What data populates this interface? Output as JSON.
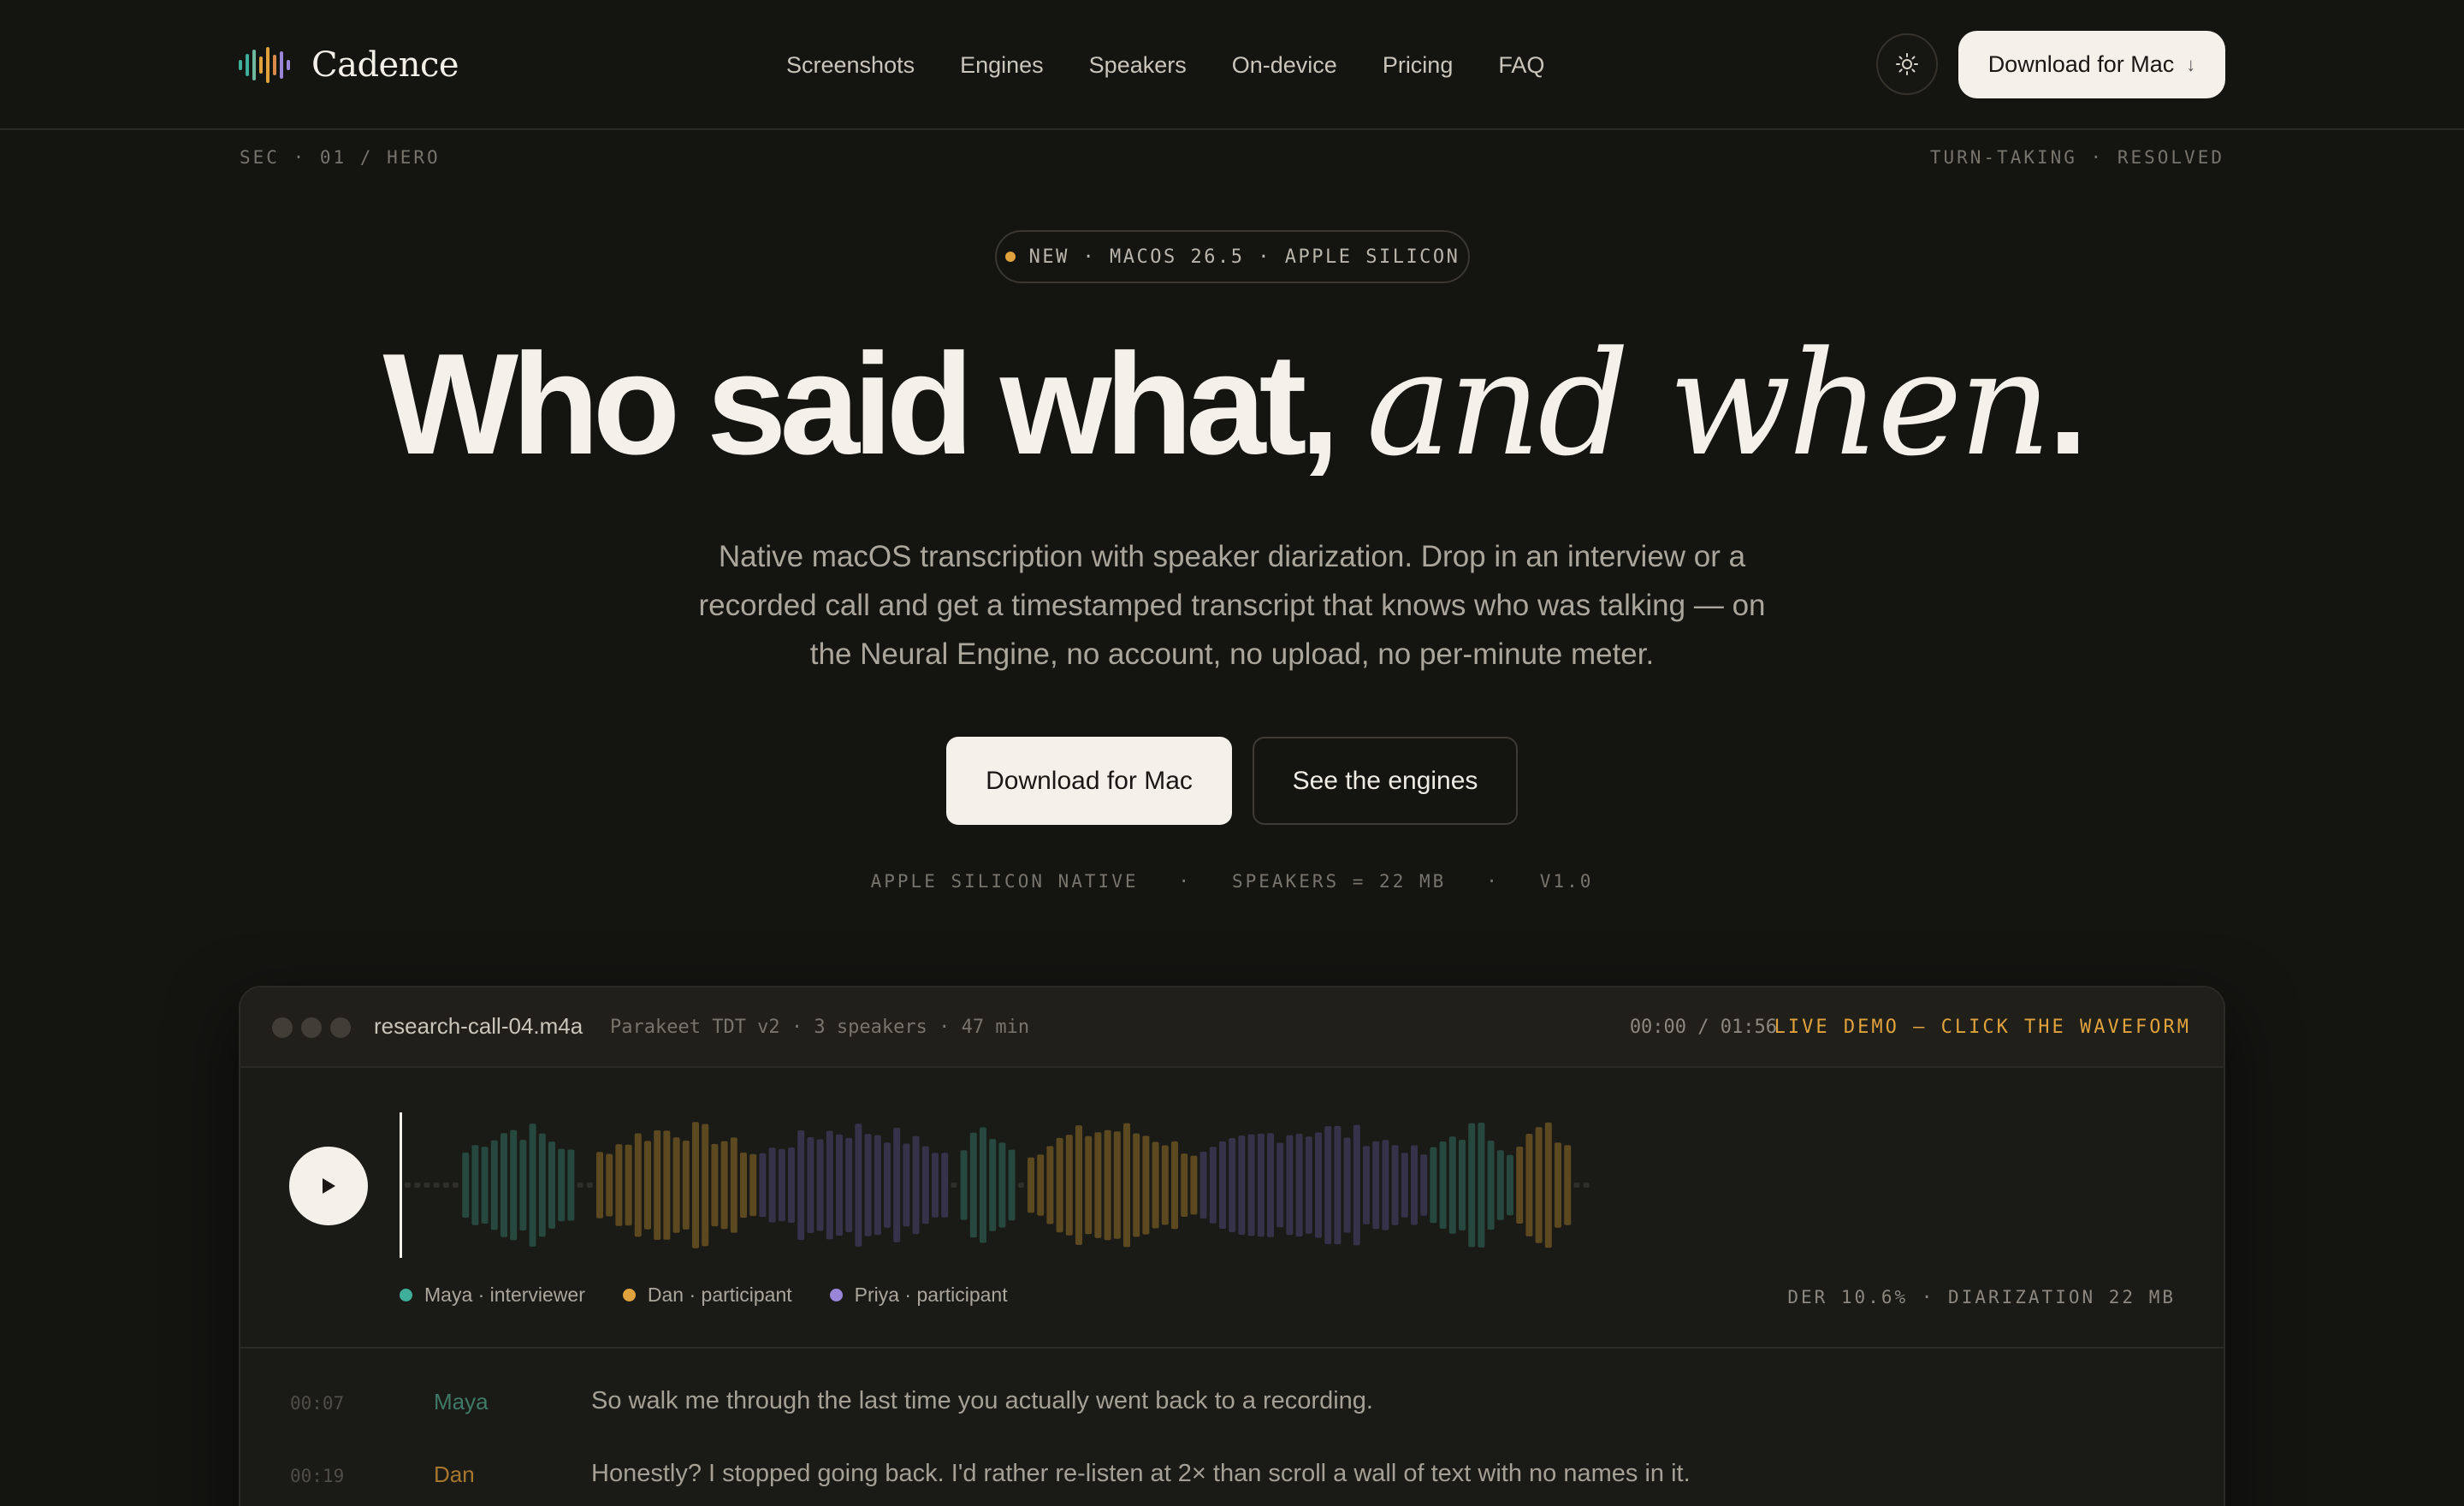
{
  "brand": {
    "name": "Cadence",
    "logo_icon": "waveform-logo-icon"
  },
  "nav": {
    "items": [
      "Screenshots",
      "Engines",
      "Speakers",
      "On-device",
      "Pricing",
      "FAQ"
    ]
  },
  "header": {
    "theme_icon": "sun-icon",
    "download_label": "Download for Mac",
    "download_arrow": "↓"
  },
  "section": {
    "left": "SEC · 01 / HERO",
    "right": "TURN-TAKING · RESOLVED"
  },
  "hero": {
    "pill": "NEW · MACOS 26.5 · APPLE SILICON",
    "headline_plain": "Who said what,",
    "headline_italic": "and when",
    "headline_end": ".",
    "subtitle": "Native macOS transcription with speaker diarization. Drop in an interview or a recorded call and get a timestamped transcript that knows who was talking — on the Neural Engine, no account, no upload, no per-minute meter.",
    "primary_button": "Download for Mac",
    "secondary_button": "See the engines",
    "specs": "APPLE SILICON NATIVE   ·   SPEAKERS = 22 MB   ·   V1.0"
  },
  "demo": {
    "filename": "research-call-04.m4a",
    "fileinfo": "Parakeet TDT v2 · 3 speakers · 47 min",
    "timecode": "00:00 / 01:56",
    "live_label": "LIVE DEMO — CLICK THE WAVEFORM",
    "play_icon": "play-icon",
    "playback_progress": 0,
    "metrics": "DER 10.6% · DIARIZATION 22 MB",
    "speakers": [
      {
        "label": "Maya · interviewer",
        "color": "#3fae9a"
      },
      {
        "label": "Dan · participant",
        "color": "#e0a23c"
      },
      {
        "label": "Priya · participant",
        "color": "#9a86d8"
      }
    ],
    "colors": {
      "maya_bar": "#27483f",
      "dan_bar": "#5c4920",
      "priya_bar": "#36324a",
      "silence_bar": "#2f2e28",
      "maya_name": "#3f7a68",
      "dan_name": "#a8772e"
    },
    "transcript": [
      {
        "time": "00:07",
        "speaker": "Maya",
        "text": "So walk me through the last time you actually went back to a recording."
      },
      {
        "time": "00:19",
        "speaker": "Dan",
        "text": "Honestly? I stopped going back. I'd rather re-listen at 2× than scroll a wall of text with no names in it."
      }
    ]
  }
}
